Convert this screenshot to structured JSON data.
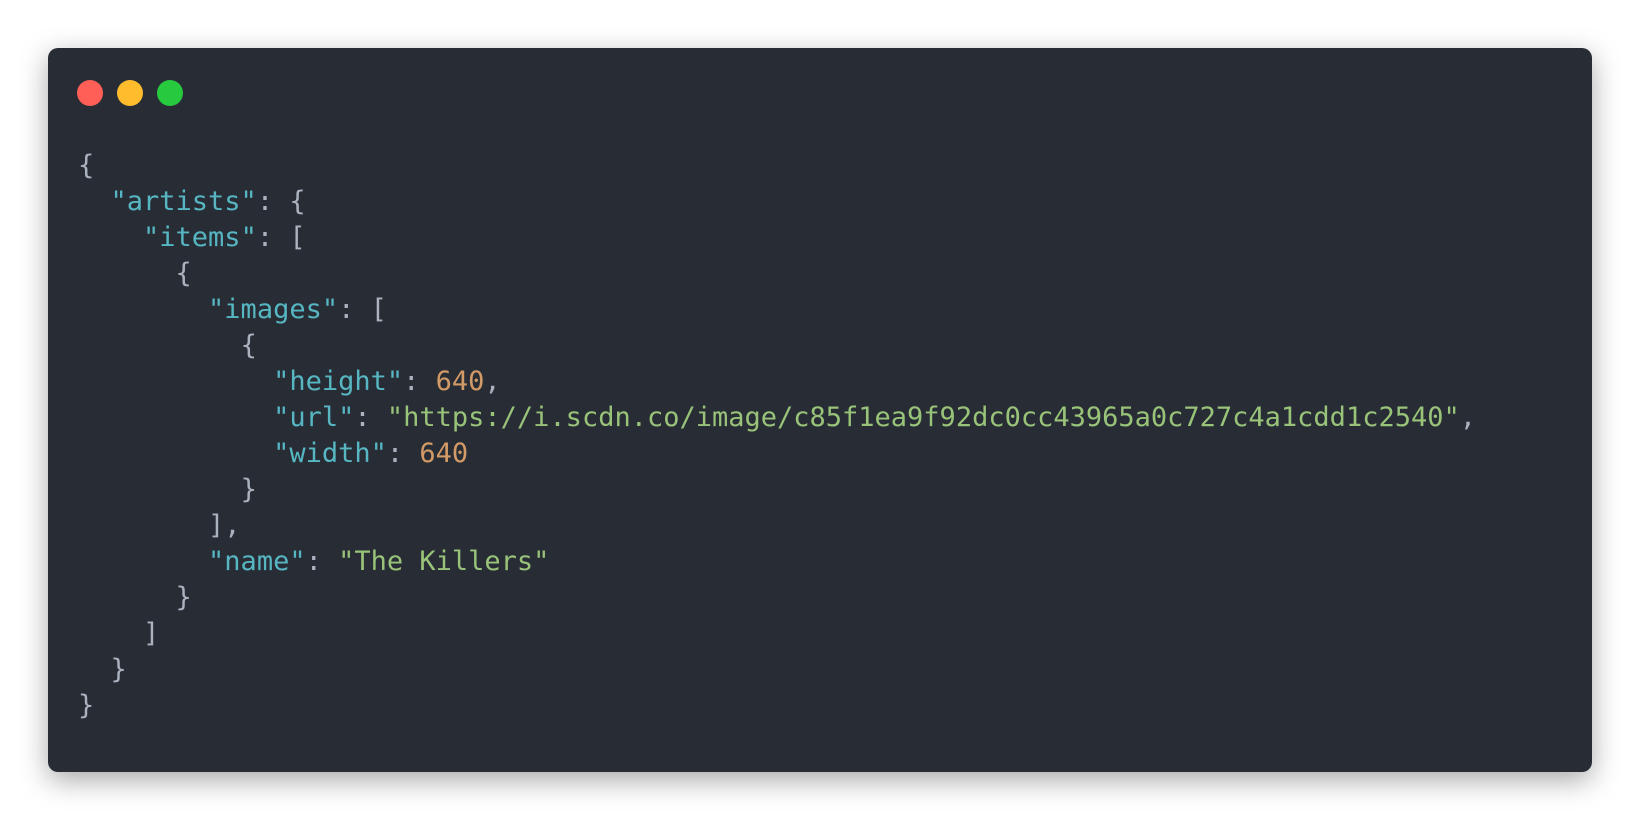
{
  "window": {
    "controls": [
      {
        "name": "close",
        "color": "#ff5f56"
      },
      {
        "name": "minimize",
        "color": "#ffbd2e"
      },
      {
        "name": "maximize",
        "color": "#27c93f"
      }
    ]
  },
  "code": {
    "lines": [
      {
        "indent": 0,
        "tokens": [
          {
            "t": "p",
            "v": "{"
          }
        ]
      },
      {
        "indent": 1,
        "tokens": [
          {
            "t": "k",
            "v": "\"artists\""
          },
          {
            "t": "p",
            "v": ": {"
          }
        ]
      },
      {
        "indent": 2,
        "tokens": [
          {
            "t": "k",
            "v": "\"items\""
          },
          {
            "t": "p",
            "v": ": ["
          }
        ]
      },
      {
        "indent": 3,
        "tokens": [
          {
            "t": "p",
            "v": "{"
          }
        ]
      },
      {
        "indent": 4,
        "tokens": [
          {
            "t": "k",
            "v": "\"images\""
          },
          {
            "t": "p",
            "v": ": ["
          }
        ]
      },
      {
        "indent": 5,
        "tokens": [
          {
            "t": "p",
            "v": "{"
          }
        ]
      },
      {
        "indent": 6,
        "tokens": [
          {
            "t": "k",
            "v": "\"height\""
          },
          {
            "t": "p",
            "v": ": "
          },
          {
            "t": "n",
            "v": "640"
          },
          {
            "t": "p",
            "v": ","
          }
        ]
      },
      {
        "indent": 6,
        "tokens": [
          {
            "t": "k",
            "v": "\"url\""
          },
          {
            "t": "p",
            "v": ": "
          },
          {
            "t": "s",
            "v": "\"https://i.scdn.co/image/c85f1ea9f92dc0cc43965a0c727c4a1cdd1c2540\""
          },
          {
            "t": "p",
            "v": ","
          }
        ]
      },
      {
        "indent": 6,
        "tokens": [
          {
            "t": "k",
            "v": "\"width\""
          },
          {
            "t": "p",
            "v": ": "
          },
          {
            "t": "n",
            "v": "640"
          }
        ]
      },
      {
        "indent": 5,
        "tokens": [
          {
            "t": "p",
            "v": "}"
          }
        ]
      },
      {
        "indent": 4,
        "tokens": [
          {
            "t": "p",
            "v": "],"
          }
        ]
      },
      {
        "indent": 4,
        "tokens": [
          {
            "t": "k",
            "v": "\"name\""
          },
          {
            "t": "p",
            "v": ": "
          },
          {
            "t": "s",
            "v": "\"The Killers\""
          }
        ]
      },
      {
        "indent": 3,
        "tokens": [
          {
            "t": "p",
            "v": "}"
          }
        ]
      },
      {
        "indent": 2,
        "tokens": [
          {
            "t": "p",
            "v": "]"
          }
        ]
      },
      {
        "indent": 1,
        "tokens": [
          {
            "t": "p",
            "v": "}"
          }
        ]
      },
      {
        "indent": 0,
        "tokens": [
          {
            "t": "p",
            "v": "}"
          }
        ]
      }
    ]
  },
  "colors": {
    "background": "#282c35",
    "key": "#56b6c2",
    "string": "#98c379",
    "number": "#d19a66",
    "punctuation": "#abb2bf"
  }
}
